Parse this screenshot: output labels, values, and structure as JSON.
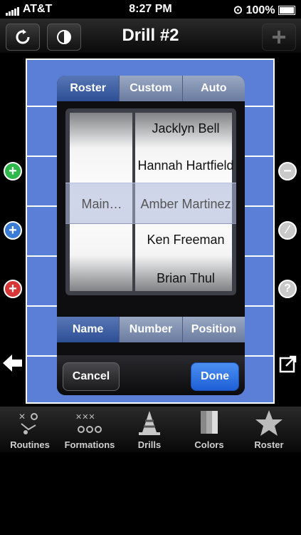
{
  "status": {
    "carrier": "AT&T",
    "time": "8:27 PM",
    "battery": "100%"
  },
  "nav": {
    "title": "Drill #2"
  },
  "dialog": {
    "top_segments": [
      {
        "label": "Roster",
        "selected": true
      },
      {
        "label": "Custom",
        "selected": false
      },
      {
        "label": "Auto",
        "selected": false
      }
    ],
    "picker": {
      "left_selected": "Main…",
      "names": [
        "Jacklyn Bell",
        "Hannah Hartfield",
        "Amber Martinez",
        "Ken Freeman",
        "Brian Thul"
      ],
      "selected_name": "Amber Martinez"
    },
    "sort_segments": [
      {
        "label": "Name",
        "selected": true
      },
      {
        "label": "Number",
        "selected": false
      },
      {
        "label": "Position",
        "selected": false
      }
    ],
    "cancel_label": "Cancel",
    "done_label": "Done"
  },
  "tabs": [
    {
      "label": "Routines",
      "icon": "routines-icon"
    },
    {
      "label": "Formations",
      "icon": "formations-icon"
    },
    {
      "label": "Drills",
      "icon": "drills-cone-icon"
    },
    {
      "label": "Colors",
      "icon": "colors-icon"
    },
    {
      "label": "Roster",
      "icon": "star-icon"
    }
  ],
  "colors": {
    "field": "#5b7fd6",
    "done": "#2f6fe0",
    "add_green": "#2eb84c",
    "add_blue": "#3a7bd5",
    "add_red": "#d73737"
  }
}
